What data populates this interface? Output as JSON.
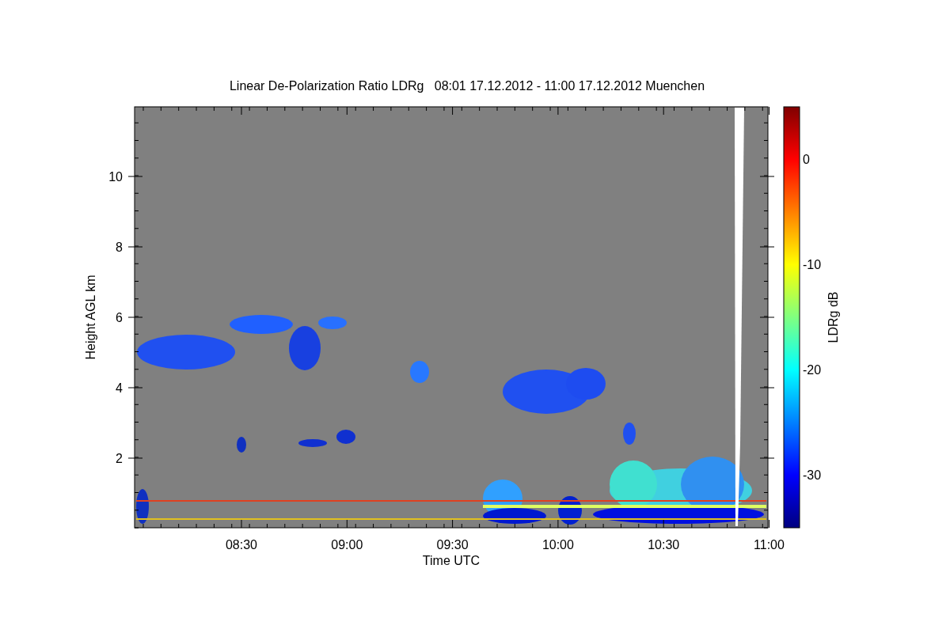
{
  "title": "Linear De-Polarization Ratio LDRg   08:01 17.12.2012 - 11:00 17.12.2012 Muenchen",
  "x_axis": {
    "label": "Time UTC",
    "ticks": [
      "08:30",
      "09:00",
      "09:30",
      "10:00",
      "10:30",
      "11:00"
    ]
  },
  "y_axis": {
    "label": "Height AGL km",
    "ticks": [
      "10",
      "8",
      "6",
      "4",
      "2"
    ]
  },
  "colorbar": {
    "label": "LDRg dB",
    "ticks": [
      "0",
      "-10",
      "-20",
      "-30"
    ]
  }
}
